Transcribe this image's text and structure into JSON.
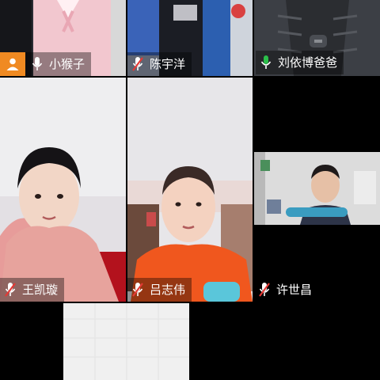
{
  "participants": [
    {
      "name": "小猴子",
      "mic": "on",
      "host": true
    },
    {
      "name": "陈宇洋",
      "mic": "muted"
    },
    {
      "name": "刘依博爸爸",
      "mic": "on",
      "active_speaker": true
    },
    {
      "name": "王凯璇",
      "mic": "muted"
    },
    {
      "name": "吕志伟",
      "mic": "muted"
    },
    {
      "name": "",
      "mic": "off",
      "empty": true
    },
    {
      "name": "许世昌",
      "mic": "muted"
    },
    {
      "name": "",
      "mic": "off",
      "partial": true
    },
    {
      "name": "",
      "mic": "off",
      "empty": true
    }
  ],
  "colors": {
    "host_badge": "#f08a22",
    "mic_on": "#2bbf4a",
    "mic_muted": "#e53935",
    "active_border": "#2bbf4a"
  },
  "icons": {
    "host": "person-icon",
    "mic_on": "microphone-icon",
    "mic_muted": "microphone-muted-icon"
  }
}
